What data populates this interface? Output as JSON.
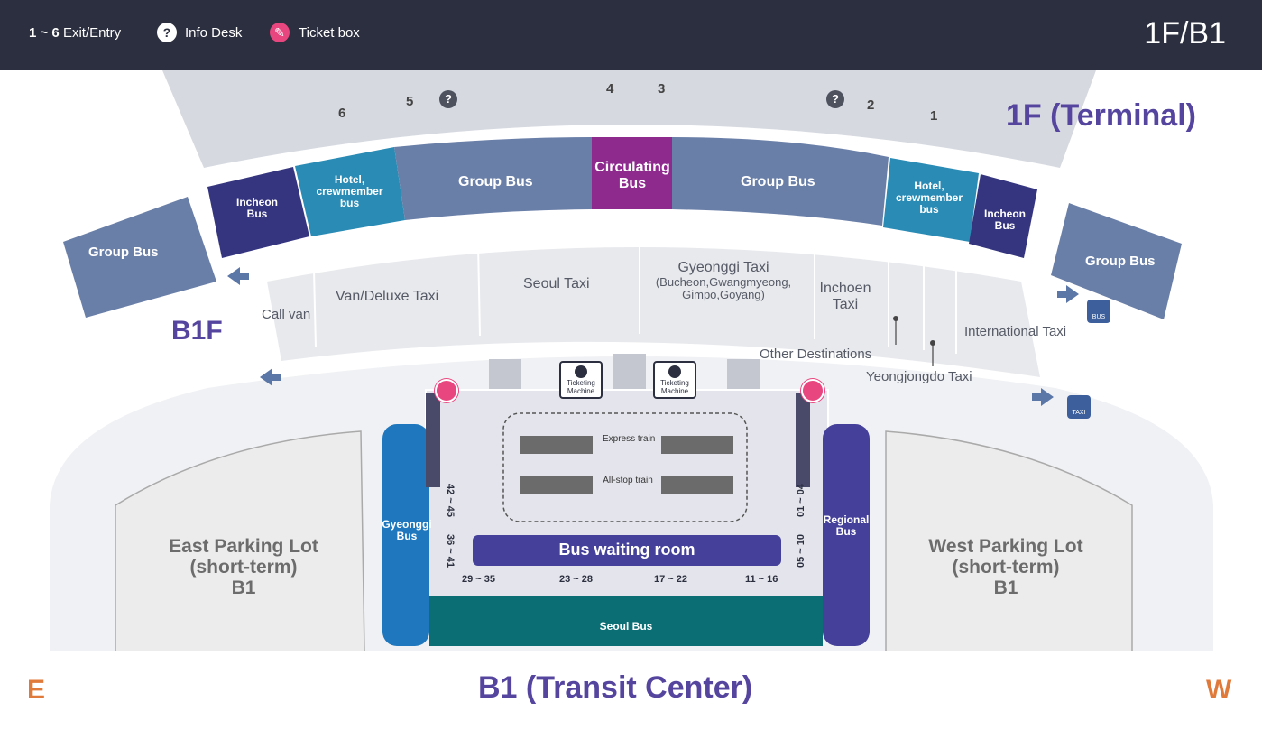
{
  "header": {
    "exit_range": "1 ~ 6",
    "exit_label": "Exit/Entry",
    "info_label": "Info Desk",
    "ticket_label": "Ticket box",
    "floor_code": "1F/B1"
  },
  "floor_titles": {
    "terminal": "1F (Terminal)",
    "b1f": "B1F",
    "transit": "B1 (Transit Center)"
  },
  "exits": [
    "6",
    "5",
    "4",
    "3",
    "2",
    "1"
  ],
  "bus_zones": {
    "group_bus_far_left": "Group Bus",
    "incheon_left": "Incheon Bus",
    "hotel_left": "Hotel, crewmember bus",
    "group_bus_left": "Group Bus",
    "circulating": "Circulating Bus",
    "group_bus_right": "Group Bus",
    "hotel_right": "Hotel, crewmember bus",
    "incheon_right": "Incheon Bus",
    "group_bus_far_right": "Group Bus"
  },
  "taxi_zones": {
    "call_van": "Call van",
    "van_deluxe": "Van/Deluxe Taxi",
    "seoul": "Seoul Taxi",
    "gyeonggi_title": "Gyeonggi Taxi",
    "gyeonggi_sub1": "(Bucheon,Gwangmyeong,",
    "gyeonggi_sub2": "Gimpo,Goyang)",
    "incheon": "Inchoen Taxi",
    "other": "Other Destinations",
    "yeongjongdo": "Yeongjongdo Taxi",
    "international": "International Taxi"
  },
  "transit": {
    "ticket_machine": "Ticketing Machine",
    "express_train": "Express train",
    "allstop_train": "All-stop train",
    "waiting_room": "Bus waiting room",
    "gyeonggi_bus": "Gyeonggi Bus",
    "regional_bus": "Regional Bus",
    "seoul_bus": "Seoul Bus",
    "left_ranges": [
      "42 ~ 45",
      "36 ~ 41"
    ],
    "right_ranges": [
      "01 ~ 04",
      "05 ~ 10"
    ],
    "bottom_ranges": [
      "29 ~ 35",
      "23 ~ 28",
      "17 ~ 22",
      "11 ~ 16"
    ]
  },
  "parking": {
    "east_line1": "East Parking Lot",
    "east_line2": "(short-term)",
    "east_line3": "B1",
    "west_line1": "West Parking Lot",
    "west_line2": "(short-term)",
    "west_line3": "B1"
  },
  "compass": {
    "east": "E",
    "west": "W"
  },
  "icons": {
    "bus_sign": "BUS",
    "taxi_sign": "TAXI"
  },
  "colors": {
    "header_bg": "#2c2f3f",
    "group_bus": "#6a7fa8",
    "incheon_bus": "#35357f",
    "hotel_bus": "#2a8bb5",
    "circulating_bus": "#8e2a8e",
    "seoul_bus": "#0b6e74",
    "gyeonggi_bus": "#1f78bd",
    "regional_bus": "#45409a",
    "title_purple": "#56459f",
    "compass_orange": "#e07a3a"
  }
}
